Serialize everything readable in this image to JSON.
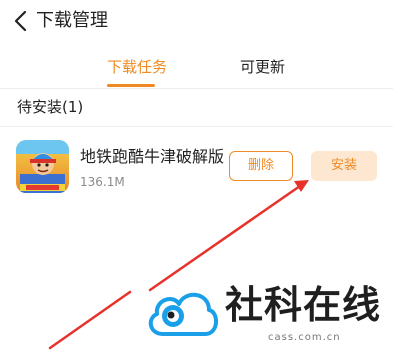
{
  "header": {
    "title": "下载管理",
    "back_icon": "chevron-left-icon"
  },
  "tabs": [
    {
      "label": "下载任务",
      "active": true
    },
    {
      "label": "可更新",
      "active": false
    }
  ],
  "section": {
    "title": "待安装(1)"
  },
  "apps": [
    {
      "name": "地铁跑酷牛津破解版",
      "size": "136.1M",
      "icon": "subway-surfers-app-icon",
      "delete_label": "删除",
      "install_label": "安装"
    }
  ],
  "colors": {
    "accent": "#f08a24",
    "install_bg": "#fde7d0",
    "arrow": "#e8312a",
    "logo_blue": "#1aa0e8"
  },
  "watermark": {
    "text": "社科在线",
    "domain": "cass.com.cn"
  }
}
